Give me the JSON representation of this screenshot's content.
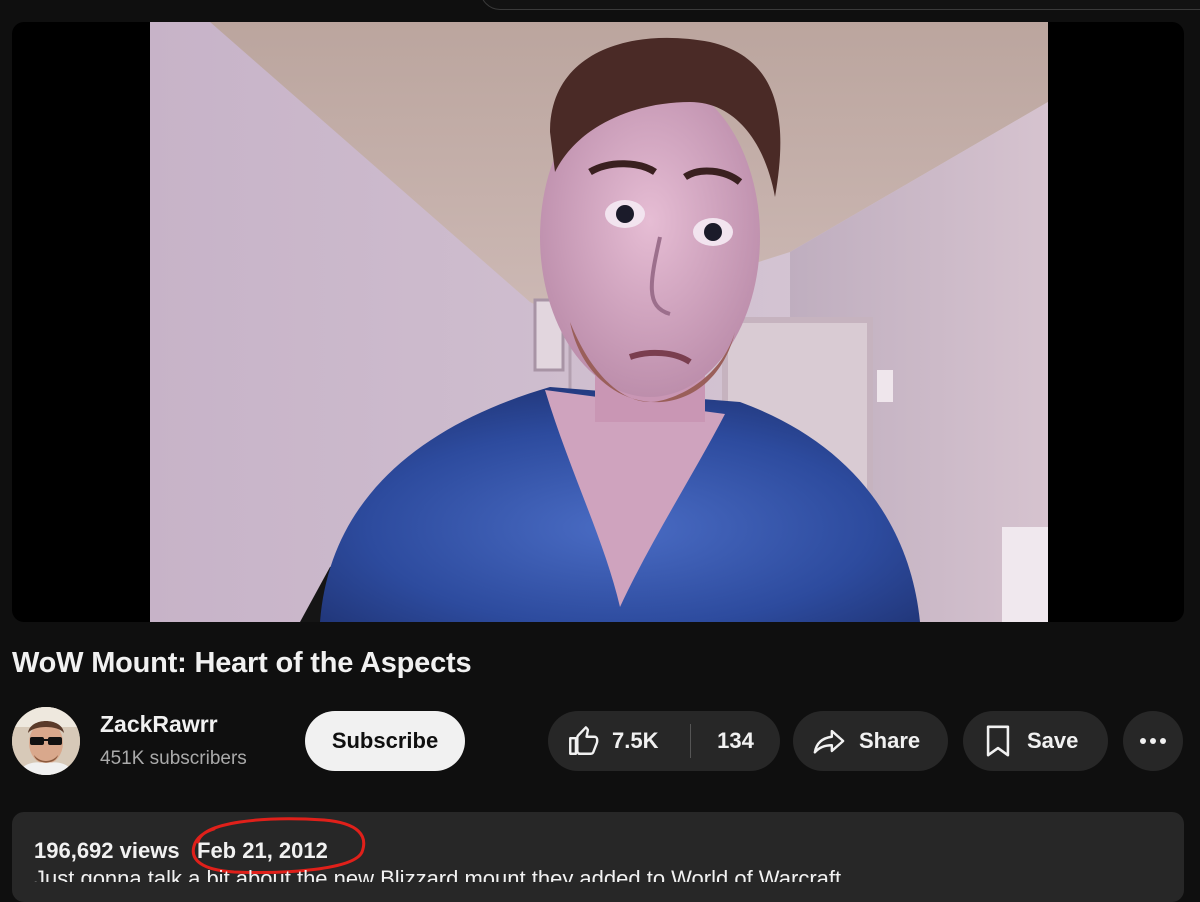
{
  "video": {
    "title": "WoW Mount: Heart of the Aspects"
  },
  "channel": {
    "name": "ZackRawrr",
    "subscribers": "451K subscribers"
  },
  "actions": {
    "subscribe_label": "Subscribe",
    "likes": "7.5K",
    "dislikes": "134",
    "share_label": "Share",
    "save_label": "Save"
  },
  "description": {
    "views": "196,692 views",
    "date": "Feb 21, 2012",
    "first_line": "Just gonna talk a bit about the new Blizzard mount they added to World of Warcraft..."
  },
  "icons": {
    "like": "thumbs-up-icon",
    "share": "share-arrow-icon",
    "save": "bookmark-icon",
    "more": "more-horizontal-icon"
  },
  "colors": {
    "background": "#0f0f0f",
    "pill": "#272727",
    "subscribe_bg": "#f1f1f1",
    "annotation": "#e0201a"
  }
}
